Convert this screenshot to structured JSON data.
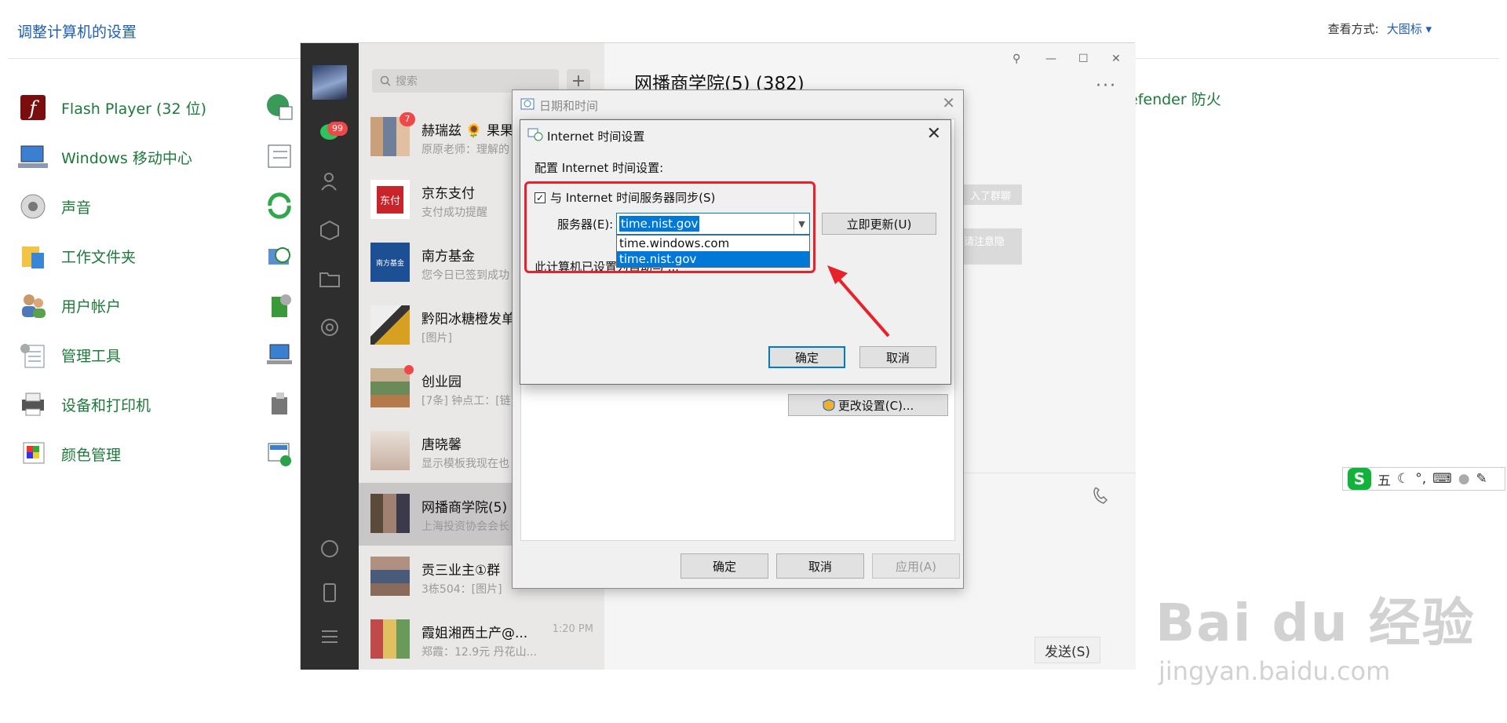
{
  "control_panel": {
    "title": "调整计算机的设置",
    "view_label": "查看方式:",
    "view_value": "大图标 ▾",
    "items": [
      {
        "label": "Flash Player (32 位)",
        "icon": "flash-icon"
      },
      {
        "label": "Windows 移动中心",
        "icon": "mobility-icon"
      },
      {
        "label": "声音",
        "icon": "speaker-icon"
      },
      {
        "label": "工作文件夹",
        "icon": "folder-icon"
      },
      {
        "label": "用户帐户",
        "icon": "users-icon"
      },
      {
        "label": "管理工具",
        "icon": "admin-tools-icon"
      },
      {
        "label": "设备和打印机",
        "icon": "printer-icon"
      },
      {
        "label": "颜色管理",
        "icon": "color-management-icon"
      }
    ],
    "partial_item": "efender 防火"
  },
  "wechat": {
    "search_placeholder": "搜索",
    "plus": "+",
    "unread_total": "99",
    "chat_title": "网播商学院(5) (382)",
    "more": "···",
    "send_label": "发送(S)",
    "hint1": "入了群聊",
    "hint2": "请注意隐",
    "chats": [
      {
        "name": "赫瑞兹 🌻 果果",
        "preview": "原原老师：理解的",
        "time": "",
        "badge": "7"
      },
      {
        "name": "京东支付",
        "preview": "支付成功提醒",
        "time": "",
        "badge": ""
      },
      {
        "name": "南方基金",
        "preview": "您今日已签到成功",
        "time": "",
        "badge": ""
      },
      {
        "name": "黔阳冰糖橙发单",
        "preview": "[图片]",
        "time": "",
        "badge": ""
      },
      {
        "name": "创业园",
        "preview": "[7条] 钟点工：[链",
        "time": "",
        "badge": "dot"
      },
      {
        "name": "唐晓馨",
        "preview": "显示模板我现在也",
        "time": "",
        "badge": ""
      },
      {
        "name": "网播商学院(5)",
        "preview": "上海投资协会会长",
        "time": "",
        "badge": ""
      },
      {
        "name": "贡三业主①群",
        "preview": "3栋504：[图片]",
        "time": "",
        "badge": ""
      },
      {
        "name": "霞姐湘西土产@...",
        "preview": "郑霞：12.9元 丹花山...",
        "time": "1:20 PM",
        "badge": ""
      }
    ],
    "jd_logo": "东付",
    "nf_logo": "南方基金"
  },
  "datetime_dialog": {
    "title": "日期和时间",
    "change_settings": "更改设置(C)...",
    "ok": "确定",
    "cancel": "取消",
    "apply": "应用(A)"
  },
  "internet_time_dialog": {
    "title": "Internet 时间设置",
    "config_label": "配置 Internet 时间设置:",
    "sync_label": "与 Internet 时间服务器同步(S)",
    "sync_checked": true,
    "server_label": "服务器(E):",
    "server_value": "time.nist.gov",
    "options": [
      "time.windows.com",
      "time.nist.gov"
    ],
    "highlighted_option": "time.nist.gov",
    "update_now": "立即更新(U)",
    "status_text": "此计算机已设置为自动与 ...",
    "ok": "确定",
    "cancel": "取消"
  },
  "ime_bar": {
    "logo": "S",
    "mode": "五"
  },
  "watermark": {
    "brand": "Bai du 经验",
    "url": "jingyan.baidu.com"
  },
  "colors": {
    "accent": "#0078d7",
    "annotation": "#e8222a",
    "link_green": "#1c7a3a"
  }
}
